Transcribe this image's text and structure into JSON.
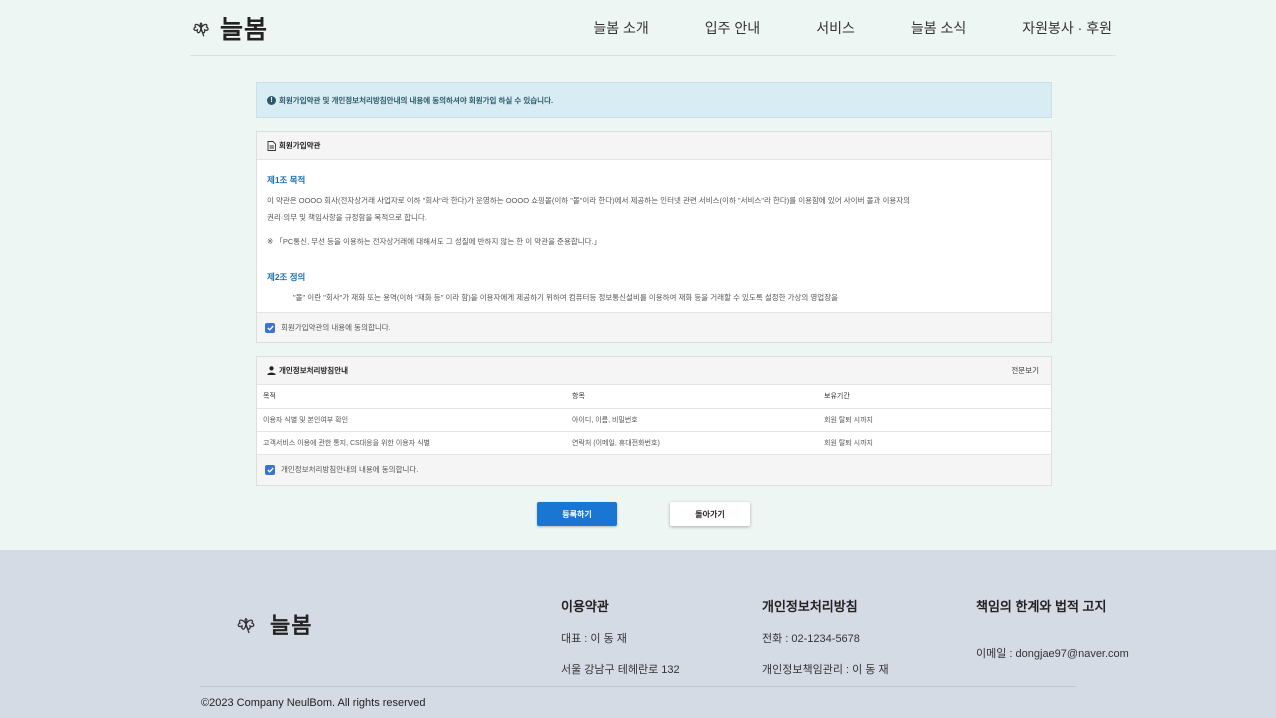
{
  "header": {
    "logo": "늘봄",
    "nav": [
      "늘봄 소개",
      "입주 안내",
      "서비스",
      "늘봄 소식",
      "자원봉사 · 후원"
    ]
  },
  "notice": "회원가입약관 및 개인정보처리방침안내의 내용에 동의하셔야 회원가입 하실 수 있습니다.",
  "terms": {
    "title": "회원가입약관",
    "art1_title": "제1조 목적",
    "art1_p1": "이 약관은 OOOO 회사(전자상거래 사업자로 이하 \"회사\"라 한다)가 운영하는 OOOO 쇼핑몰(이하 \"몰\"이라 한다)에서 제공하는 인터넷 관련 서비스(이하 \"서비스\"라 한다)를 이용함에 있어 사이버 몰과 이용자의",
    "art1_p2": "권리·의무 및 책임사항을 규정함을 목적으로 합니다.",
    "art1_note": "※ 「PC통신, 무선 등을 이용하는 전자상거래에 대해서도 그 성질에 반하지 않는 한 이 약관을 준용합니다.」",
    "art2_title": "제2조 정의",
    "art2_p1": "\"몰\" 이란 \"회사\"가 재화 또는 용역(이하 \"재화 등\" 이라 함)을 이용자에게 제공하기 위하여 컴퓨터등 정보통신설비를 이용하여 재화 등을 거래할 수 있도록 설정한 가상의 영업장을",
    "agree": "회원가입약관의 내용에 동의합니다."
  },
  "privacy": {
    "title": "개인정보처리방침안내",
    "view_all": "전문보기",
    "headers": [
      "목적",
      "항목",
      "보유기간"
    ],
    "rows": [
      [
        "이용자 식별 및 본인여부 확인",
        "아이디, 이름, 비밀번호",
        "회원 탈퇴 시까지"
      ],
      [
        "고객서비스 이용에 관한 통지, CS대응을 위한 이용자 식별",
        "연락처 (이메일, 휴대전화번호)",
        "회원 탈퇴 시까지"
      ]
    ],
    "agree": "개인정보처리방침안내의 내용에 동의합니다."
  },
  "buttons": {
    "register": "등록하기",
    "back": "돌아가기"
  },
  "footer": {
    "logo": "늘봄",
    "col1_title": "이용약관",
    "col1_line1": "대표 : 이 동 재",
    "col1_line2": "서울 강남구 테헤란로 132",
    "col2_title": "개인정보처리방침",
    "col2_line1": "전화 : 02-1234-5678",
    "col2_line2": "개인정보책임관리 : 이 동 재",
    "col3_title": "책임의 한계와 법적 고지",
    "col3_line1": "이메일 : dongjae97@naver.com",
    "copyright": "©2023 Company NeulBom. All rights reserved"
  },
  "colors": {
    "primary": "#1976d2",
    "check": "#3b73d4",
    "heading": "#1a6fb0",
    "page_bg": "#eef6f4",
    "footer_bg": "#d4dbe5"
  }
}
